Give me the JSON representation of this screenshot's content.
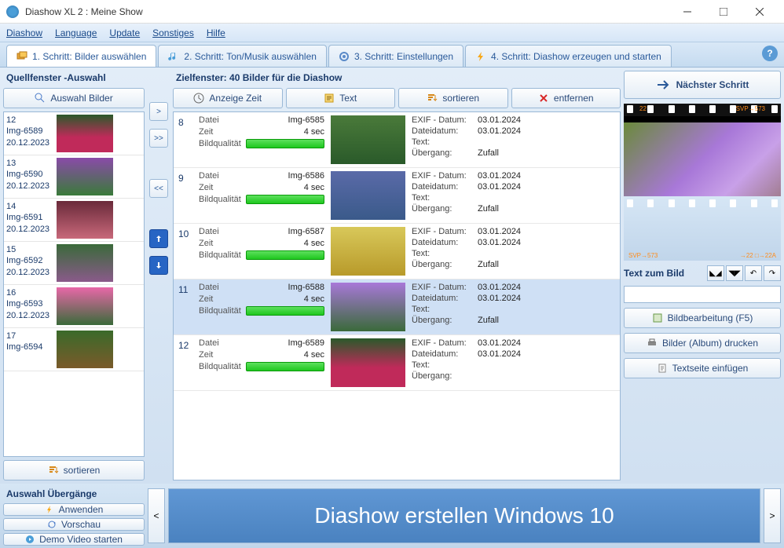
{
  "window": {
    "title": "Diashow XL 2 : Meine Show"
  },
  "menu": {
    "diashow": "Diashow",
    "language": "Language",
    "update": "Update",
    "sonstiges": "Sonstiges",
    "hilfe": "Hilfe"
  },
  "tabs": {
    "t1": "1. Schritt: Bilder auswählen",
    "t2": "2. Schritt: Ton/Musik auswählen",
    "t3": "3. Schritt: Einstellungen",
    "t4": "4. Schritt: Diashow erzeugen und starten"
  },
  "source": {
    "title": "Quellfenster -Auswahl",
    "select_btn": "Auswahl Bilder",
    "sort_btn": "sortieren",
    "items": [
      {
        "num": "12",
        "name": "Img-6589",
        "date": "20.12.2023"
      },
      {
        "num": "13",
        "name": "Img-6590",
        "date": "20.12.2023"
      },
      {
        "num": "14",
        "name": "Img-6591",
        "date": "20.12.2023"
      },
      {
        "num": "15",
        "name": "Img-6592",
        "date": "20.12.2023"
      },
      {
        "num": "16",
        "name": "Img-6593",
        "date": "20.12.2023"
      },
      {
        "num": "17",
        "name": "Img-6594",
        "date": ""
      }
    ]
  },
  "arrows": {
    "single": ">",
    "all": ">>",
    "back": "<<",
    "up": "↕",
    "down": "↨"
  },
  "target": {
    "title": "Zielfenster: 40 Bilder für die Diashow",
    "toolbar": {
      "time": "Anzeige Zeit",
      "text": "Text",
      "sort": "sortieren",
      "remove": "entfernen"
    },
    "labels": {
      "datei": "Datei",
      "zeit": "Zeit",
      "qual": "Bildqualität",
      "exif": "EXIF - Datum:",
      "filedate": "Dateidatum:",
      "text": "Text:",
      "trans": "Übergang:"
    },
    "rows": [
      {
        "num": "8",
        "file": "Img-6585",
        "time": "4 sec",
        "exif": "03.01.2024",
        "filedate": "03.01.2024",
        "text": "",
        "trans": "Zufall"
      },
      {
        "num": "9",
        "file": "Img-6586",
        "time": "4 sec",
        "exif": "03.01.2024",
        "filedate": "03.01.2024",
        "text": "",
        "trans": "Zufall"
      },
      {
        "num": "10",
        "file": "Img-6587",
        "time": "4 sec",
        "exif": "03.01.2024",
        "filedate": "03.01.2024",
        "text": "",
        "trans": "Zufall"
      },
      {
        "num": "11",
        "file": "Img-6588",
        "time": "4 sec",
        "exif": "03.01.2024",
        "filedate": "03.01.2024",
        "text": "",
        "trans": "Zufall"
      },
      {
        "num": "12",
        "file": "Img-6589",
        "time": "4 sec",
        "exif": "03.01.2024",
        "filedate": "03.01.2024",
        "text": "",
        "trans": ""
      }
    ]
  },
  "preview": {
    "next": "Nächster Schritt",
    "text_label": "Text zum Bild",
    "edit_btn": "Bildbearbeitung (F5)",
    "print_btn": "Bilder (Album) drucken",
    "insert_btn": "Textseite einfügen",
    "film_tl": "22",
    "film_tr": "SVP→573",
    "film_bl": "SVP→573",
    "film_br": "→22 □→22A"
  },
  "transitions": {
    "title": "Auswahl Übergänge",
    "apply": "Anwenden",
    "preview": "Vorschau",
    "demo": "Demo Video starten"
  },
  "banner": {
    "text": "Diashow erstellen Windows 10",
    "left": "<",
    "right": ">"
  }
}
